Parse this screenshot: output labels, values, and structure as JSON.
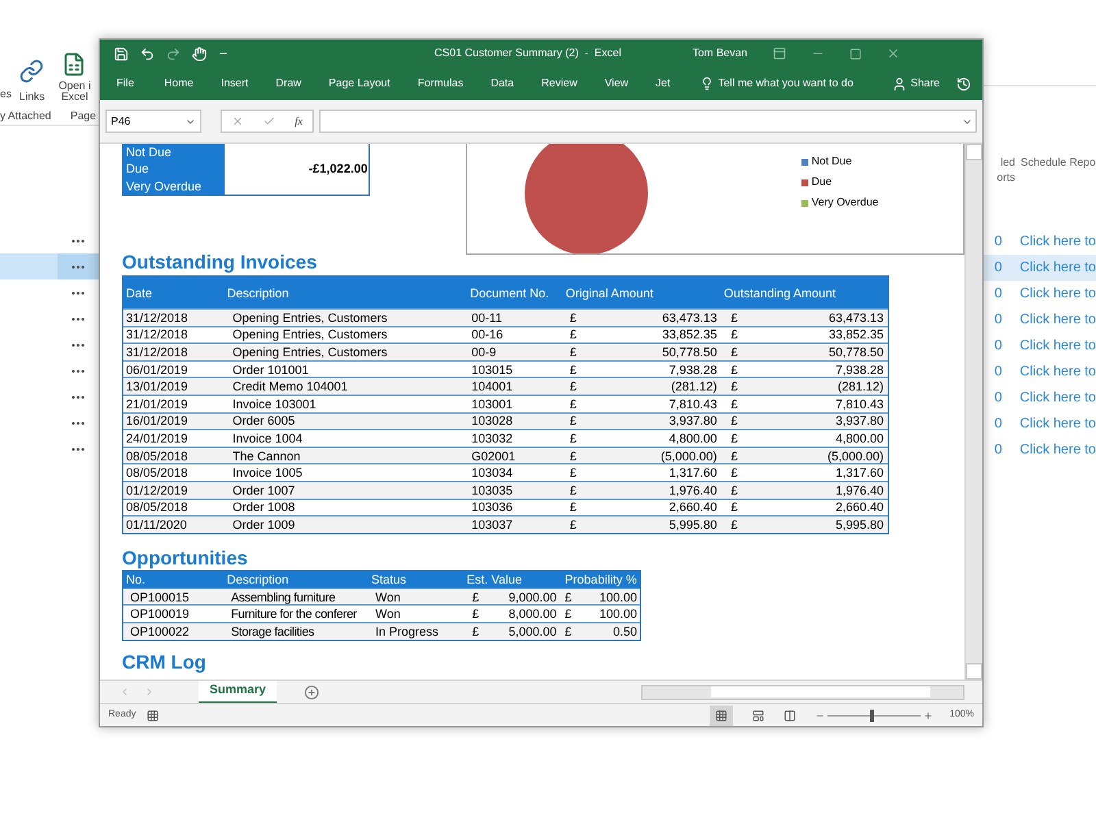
{
  "background_app": {
    "ribbon": {
      "buttons": [
        {
          "kind": "partial",
          "label": "es"
        },
        {
          "kind": "link",
          "label": "Links"
        },
        {
          "kind": "excel",
          "lines": [
            "Open i",
            "Excel"
          ]
        }
      ],
      "groups": [
        "y Attached",
        "Page"
      ]
    },
    "list_rows": [
      {
        "selected": false
      },
      {
        "selected": true
      },
      {
        "selected": false
      },
      {
        "selected": false
      },
      {
        "selected": false
      },
      {
        "selected": false
      },
      {
        "selected": false
      },
      {
        "selected": false
      },
      {
        "selected": false
      }
    ],
    "side_table": {
      "columns": [
        {
          "lines": [
            "led",
            "orts"
          ]
        },
        {
          "lines": [
            "Schedule Repo"
          ]
        }
      ],
      "rows": [
        {
          "count": "0",
          "link": "Click here to",
          "selected": false
        },
        {
          "count": "0",
          "link": "Click here to",
          "selected": true
        },
        {
          "count": "0",
          "link": "Click here to",
          "selected": false
        },
        {
          "count": "0",
          "link": "Click here to",
          "selected": false
        },
        {
          "count": "0",
          "link": "Click here to",
          "selected": false
        },
        {
          "count": "0",
          "link": "Click here to",
          "selected": false
        },
        {
          "count": "0",
          "link": "Click here to",
          "selected": false
        },
        {
          "count": "0",
          "link": "Click here to",
          "selected": false
        },
        {
          "count": "0",
          "link": "Click here to",
          "selected": false
        }
      ]
    }
  },
  "excel": {
    "window": {
      "title": "CS01 Customer Summary (2)  -  Excel",
      "user": "Tom Bevan"
    },
    "ribbon_tabs": [
      "File",
      "Home",
      "Insert",
      "Draw",
      "Page Layout",
      "Formulas",
      "Data",
      "Review",
      "View",
      "Jet"
    ],
    "tell_me": "Tell me what you want to do",
    "share": "Share",
    "formula_bar": {
      "name_box": "P46",
      "function_label": "fx"
    },
    "sheet": {
      "summary_rows": [
        {
          "label": "Not Due",
          "value": ""
        },
        {
          "label": "Due",
          "value": "-£1,022.00"
        },
        {
          "label": "Very Overdue",
          "value": ""
        }
      ],
      "chart": {
        "legend": [
          {
            "color": "#4f81bd"
          },
          {
            "color": "#c0504d"
          },
          {
            "color": "#9bbb59"
          }
        ],
        "chart_data": {
          "type": "pie",
          "categories": [
            "Not Due",
            "Due",
            "Very Overdue"
          ],
          "values": [
            0,
            100,
            0
          ]
        }
      },
      "invoices": {
        "title": "Outstanding Invoices",
        "columns": [
          "Date",
          "Description",
          "Document No.",
          "Original Amount",
          "Outstanding Amount"
        ],
        "rows": [
          {
            "date": "31/12/2018",
            "description": "Opening Entries, Customers",
            "document": "00-11",
            "original": "63,473.13",
            "outstanding": "63,473.13"
          },
          {
            "date": "31/12/2018",
            "description": "Opening Entries, Customers",
            "document": "00-16",
            "original": "33,852.35",
            "outstanding": "33,852.35"
          },
          {
            "date": "31/12/2018",
            "description": "Opening Entries, Customers",
            "document": "00-9",
            "original": "50,778.50",
            "outstanding": "50,778.50"
          },
          {
            "date": "06/01/2019",
            "description": "Order 101001",
            "document": "103015",
            "original": "7,938.28",
            "outstanding": "7,938.28"
          },
          {
            "date": "13/01/2019",
            "description": "Credit Memo 104001",
            "document": "104001",
            "original": "(281.12)",
            "outstanding": "(281.12)"
          },
          {
            "date": "21/01/2019",
            "description": "Invoice 103001",
            "document": "103001",
            "original": "7,810.43",
            "outstanding": "7,810.43"
          },
          {
            "date": "16/01/2019",
            "description": "Order 6005",
            "document": "103028",
            "original": "3,937.80",
            "outstanding": "3,937.80"
          },
          {
            "date": "24/01/2019",
            "description": "Invoice 1004",
            "document": "103032",
            "original": "4,800.00",
            "outstanding": "4,800.00"
          },
          {
            "date": "08/05/2018",
            "description": "The Cannon",
            "document": "G02001",
            "original": "(5,000.00)",
            "outstanding": "(5,000.00)"
          },
          {
            "date": "08/05/2018",
            "description": "Invoice 1005",
            "document": "103034",
            "original": "1,317.60",
            "outstanding": "1,317.60"
          },
          {
            "date": "01/12/2019",
            "description": "Order 1007",
            "document": "103035",
            "original": "1,976.40",
            "outstanding": "1,976.40"
          },
          {
            "date": "08/05/2018",
            "description": "Order 1008",
            "document": "103036",
            "original": "2,660.40",
            "outstanding": "2,660.40"
          },
          {
            "date": "01/11/2020",
            "description": "Order 1009",
            "document": "103037",
            "original": "5,995.80",
            "outstanding": "5,995.80"
          }
        ]
      },
      "opportunities": {
        "title": "Opportunities",
        "columns": [
          "No.",
          "Description",
          "Status",
          "Est. Value",
          "Probability %"
        ],
        "rows": [
          {
            "no": "OP100015",
            "description": "Assembling furniture",
            "status": "Won",
            "value": "9,000.00",
            "probability": "100.00"
          },
          {
            "no": "OP100019",
            "description": "Furniture for the conferer",
            "status": "Won",
            "value": "8,000.00",
            "probability": "100.00"
          },
          {
            "no": "OP100022",
            "description": "Storage facilities",
            "status": "In Progress",
            "value": "5,000.00",
            "probability": "0.50"
          }
        ]
      },
      "next_title": "CRM Log",
      "currency": "£"
    },
    "sheet_tabs": [
      {
        "label": "Summary",
        "selected": true
      }
    ],
    "status_bar": {
      "status": "Ready",
      "zoom": "100%",
      "zoom_slider": {
        "level": 0.46
      }
    }
  }
}
